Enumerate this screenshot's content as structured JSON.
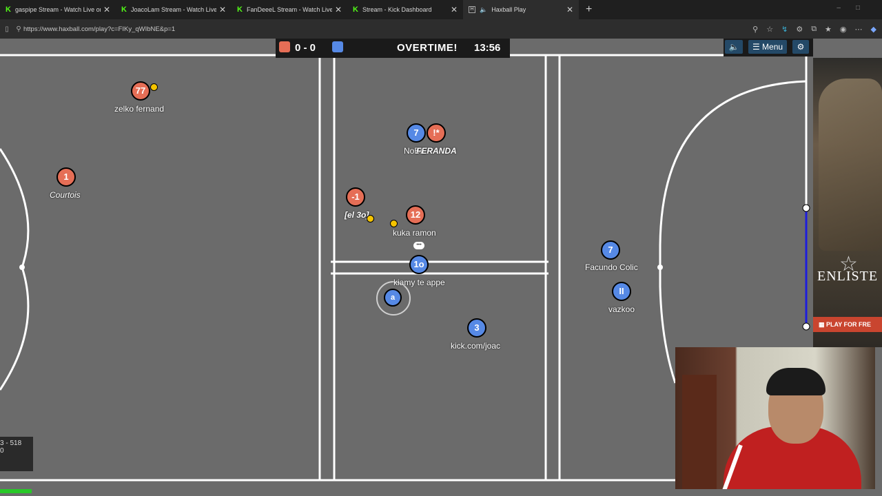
{
  "browser": {
    "tabs": [
      {
        "title": "gaspipe Stream - Watch Live on Ki",
        "icon": "kick",
        "active": false
      },
      {
        "title": "JoacoLam Stream - Watch Live on",
        "icon": "kick",
        "active": false
      },
      {
        "title": "FanDeeeL Stream - Watch Live on",
        "icon": "kick",
        "active": false
      },
      {
        "title": "Stream - Kick Dashboard",
        "icon": "kick",
        "active": false
      },
      {
        "title": "Haxball Play",
        "icon": "haxball",
        "active": true
      }
    ],
    "new_tab": "+",
    "url": "https://www.haxball.com/play?c=FIKy_qWIbNE&p=1"
  },
  "game": {
    "score": "0 - 0",
    "status": "OVERTIME!",
    "clock": "13:56",
    "menu_label": "Menu",
    "colors": {
      "red": "#e56e56",
      "blue": "#5689e5",
      "field": "#6b6b6b",
      "ball": "#f5c400"
    },
    "players": [
      {
        "id": "p1",
        "team": "red",
        "number": "77",
        "name": "zelko fernand",
        "italic": false
      },
      {
        "id": "p2",
        "team": "red",
        "number": "1",
        "name": "Courtois",
        "italic": true
      },
      {
        "id": "p3",
        "team": "blue",
        "number": "7",
        "name": "NoBIL",
        "italic": false
      },
      {
        "id": "p4",
        "team": "red",
        "number": "!*",
        "name": "FERANDA",
        "italic": true
      },
      {
        "id": "p5",
        "team": "red",
        "number": "-1",
        "name": "[el 3o]",
        "italic": true
      },
      {
        "id": "p6",
        "team": "red",
        "number": "12",
        "name": "kuka ramon",
        "italic": false
      },
      {
        "id": "p7",
        "team": "blue",
        "number": "1o",
        "name": "kiamy te appe",
        "italic": false
      },
      {
        "id": "p8",
        "team": "blue",
        "number": "3",
        "name": "kick.com/joac",
        "italic": false
      },
      {
        "id": "p9",
        "team": "blue",
        "number": "7",
        "name": "Facundo Colic",
        "italic": false
      },
      {
        "id": "p10",
        "team": "blue",
        "number": "II",
        "name": "vazkoo",
        "italic": false
      },
      {
        "id": "p11",
        "team": "blue",
        "number": "a",
        "name": "",
        "italic": false
      }
    ],
    "stats_text": "3 - 518\n0"
  },
  "ad": {
    "title": "ENLISTE",
    "cta": "PLAY FOR FRE"
  }
}
